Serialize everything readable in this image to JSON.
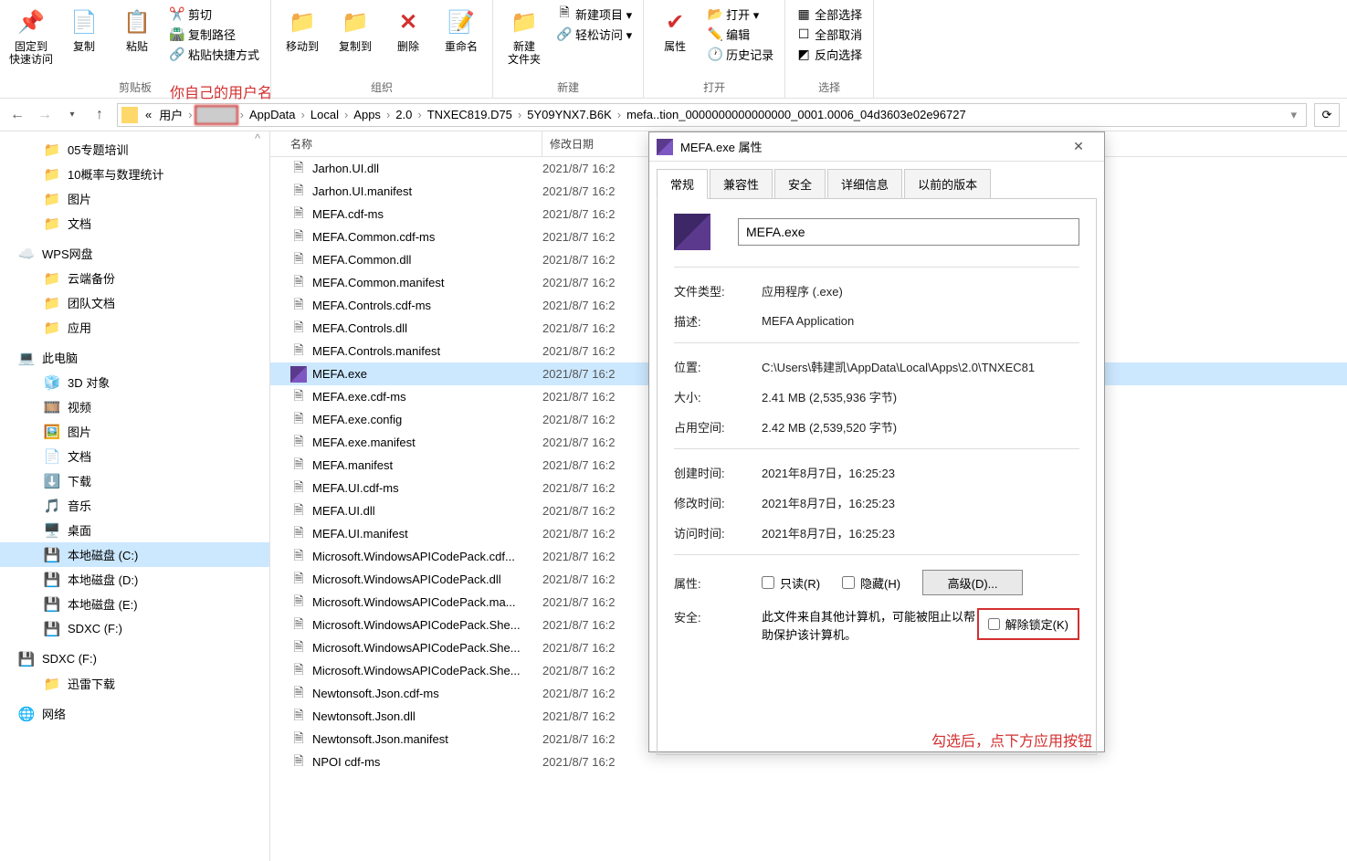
{
  "ribbon": {
    "pin": "固定到\n快速访问",
    "copy": "复制",
    "paste": "粘贴",
    "cut": "剪切",
    "copy_path": "复制路径",
    "paste_shortcut": "粘贴快捷方式",
    "move_to": "移动到",
    "copy_to": "复制到",
    "delete": "删除",
    "rename": "重命名",
    "new_folder": "新建\n文件夹",
    "new_item": "新建项目 ▾",
    "easy_access": "轻松访问 ▾",
    "properties": "属性",
    "open": "打开 ▾",
    "edit": "编辑",
    "history": "历史记录",
    "select_all": "全部选择",
    "select_none": "全部取消",
    "invert": "反向选择",
    "group_clipboard": "剪贴板",
    "group_organize": "组织",
    "group_new": "新建",
    "group_open": "打开",
    "group_select": "选择",
    "annotation_username": "你自己的用户名"
  },
  "breadcrumb": {
    "segs": [
      "«",
      "用户",
      "",
      "AppData",
      "Local",
      "Apps",
      "2.0",
      "TNXEC819.D75",
      "5Y09YNX7.B6K",
      "mefa..tion_0000000000000000_0001.0006_04d3603e02e96727"
    ]
  },
  "nav": {
    "items": [
      {
        "label": "05专题培训",
        "icon": "folder",
        "indent": 1
      },
      {
        "label": "10概率与数理统计",
        "icon": "folder",
        "indent": 1
      },
      {
        "label": "图片",
        "icon": "folder",
        "indent": 1
      },
      {
        "label": "文档",
        "icon": "folder",
        "indent": 1
      },
      {
        "label": "WPS网盘",
        "icon": "wps",
        "indent": 0,
        "group": true
      },
      {
        "label": "云端备份",
        "icon": "folder",
        "indent": 1
      },
      {
        "label": "团队文档",
        "icon": "folder",
        "indent": 1
      },
      {
        "label": "应用",
        "icon": "folder",
        "indent": 1
      },
      {
        "label": "此电脑",
        "icon": "pc",
        "indent": 0,
        "group": true
      },
      {
        "label": "3D 对象",
        "icon": "3d",
        "indent": 1
      },
      {
        "label": "视频",
        "icon": "video",
        "indent": 1
      },
      {
        "label": "图片",
        "icon": "pic",
        "indent": 1
      },
      {
        "label": "文档",
        "icon": "doc",
        "indent": 1
      },
      {
        "label": "下载",
        "icon": "down",
        "indent": 1
      },
      {
        "label": "音乐",
        "icon": "music",
        "indent": 1
      },
      {
        "label": "桌面",
        "icon": "desk",
        "indent": 1
      },
      {
        "label": "本地磁盘 (C:)",
        "icon": "disk",
        "indent": 1,
        "selected": true
      },
      {
        "label": "本地磁盘 (D:)",
        "icon": "disk",
        "indent": 1
      },
      {
        "label": "本地磁盘 (E:)",
        "icon": "disk",
        "indent": 1
      },
      {
        "label": "SDXC (F:)",
        "icon": "sd",
        "indent": 1
      },
      {
        "label": "SDXC (F:)",
        "icon": "sd",
        "indent": 0,
        "group": true
      },
      {
        "label": "迅雷下载",
        "icon": "folder",
        "indent": 1
      },
      {
        "label": "网络",
        "icon": "net",
        "indent": 0,
        "group": true
      }
    ]
  },
  "file_list": {
    "col_name": "名称",
    "col_date": "修改日期",
    "files": [
      {
        "name": "Jarhon.UI.dll",
        "date": "2021/8/7 16:2",
        "icon": "file"
      },
      {
        "name": "Jarhon.UI.manifest",
        "date": "2021/8/7 16:2",
        "icon": "file"
      },
      {
        "name": "MEFA.cdf-ms",
        "date": "2021/8/7 16:2",
        "icon": "file"
      },
      {
        "name": "MEFA.Common.cdf-ms",
        "date": "2021/8/7 16:2",
        "icon": "file"
      },
      {
        "name": "MEFA.Common.dll",
        "date": "2021/8/7 16:2",
        "icon": "file"
      },
      {
        "name": "MEFA.Common.manifest",
        "date": "2021/8/7 16:2",
        "icon": "file"
      },
      {
        "name": "MEFA.Controls.cdf-ms",
        "date": "2021/8/7 16:2",
        "icon": "file"
      },
      {
        "name": "MEFA.Controls.dll",
        "date": "2021/8/7 16:2",
        "icon": "file"
      },
      {
        "name": "MEFA.Controls.manifest",
        "date": "2021/8/7 16:2",
        "icon": "file"
      },
      {
        "name": "MEFA.exe",
        "date": "2021/8/7 16:2",
        "icon": "exe",
        "selected": true
      },
      {
        "name": "MEFA.exe.cdf-ms",
        "date": "2021/8/7 16:2",
        "icon": "file"
      },
      {
        "name": "MEFA.exe.config",
        "date": "2021/8/7 16:2",
        "icon": "file"
      },
      {
        "name": "MEFA.exe.manifest",
        "date": "2021/8/7 16:2",
        "icon": "file"
      },
      {
        "name": "MEFA.manifest",
        "date": "2021/8/7 16:2",
        "icon": "file"
      },
      {
        "name": "MEFA.UI.cdf-ms",
        "date": "2021/8/7 16:2",
        "icon": "file"
      },
      {
        "name": "MEFA.UI.dll",
        "date": "2021/8/7 16:2",
        "icon": "file"
      },
      {
        "name": "MEFA.UI.manifest",
        "date": "2021/8/7 16:2",
        "icon": "file"
      },
      {
        "name": "Microsoft.WindowsAPICodePack.cdf...",
        "date": "2021/8/7 16:2",
        "icon": "file"
      },
      {
        "name": "Microsoft.WindowsAPICodePack.dll",
        "date": "2021/8/7 16:2",
        "icon": "file"
      },
      {
        "name": "Microsoft.WindowsAPICodePack.ma...",
        "date": "2021/8/7 16:2",
        "icon": "file"
      },
      {
        "name": "Microsoft.WindowsAPICodePack.She...",
        "date": "2021/8/7 16:2",
        "icon": "file"
      },
      {
        "name": "Microsoft.WindowsAPICodePack.She...",
        "date": "2021/8/7 16:2",
        "icon": "file"
      },
      {
        "name": "Microsoft.WindowsAPICodePack.She...",
        "date": "2021/8/7 16:2",
        "icon": "file"
      },
      {
        "name": "Newtonsoft.Json.cdf-ms",
        "date": "2021/8/7 16:2",
        "icon": "file"
      },
      {
        "name": "Newtonsoft.Json.dll",
        "date": "2021/8/7 16:2",
        "icon": "file"
      },
      {
        "name": "Newtonsoft.Json.manifest",
        "date": "2021/8/7 16:2",
        "icon": "file"
      },
      {
        "name": "NPOI cdf-ms",
        "date": "2021/8/7 16:2",
        "icon": "file"
      }
    ]
  },
  "props": {
    "title": "MEFA.exe 属性",
    "tabs": [
      "常规",
      "兼容性",
      "安全",
      "详细信息",
      "以前的版本"
    ],
    "filename": "MEFA.exe",
    "rows": {
      "type_label": "文件类型:",
      "type_value": "应用程序 (.exe)",
      "desc_label": "描述:",
      "desc_value": "MEFA Application",
      "loc_label": "位置:",
      "loc_value": "C:\\Users\\韩建凯\\AppData\\Local\\Apps\\2.0\\TNXEC81",
      "size_label": "大小:",
      "size_value": "2.41 MB (2,535,936 字节)",
      "disk_label": "占用空间:",
      "disk_value": "2.42 MB (2,539,520 字节)",
      "created_label": "创建时间:",
      "created_value": "2021年8月7日，16:25:23",
      "modified_label": "修改时间:",
      "modified_value": "2021年8月7日，16:25:23",
      "accessed_label": "访问时间:",
      "accessed_value": "2021年8月7日，16:25:23",
      "attr_label": "属性:",
      "readonly": "只读(R)",
      "hidden": "隐藏(H)",
      "advanced": "高级(D)...",
      "security_label": "安全:",
      "security_text": "此文件来自其他计算机，可能被阻止以帮助保护该计算机。",
      "unblock": "解除锁定(K)"
    },
    "annotation_check": "勾选后，点下方应用按钮"
  }
}
